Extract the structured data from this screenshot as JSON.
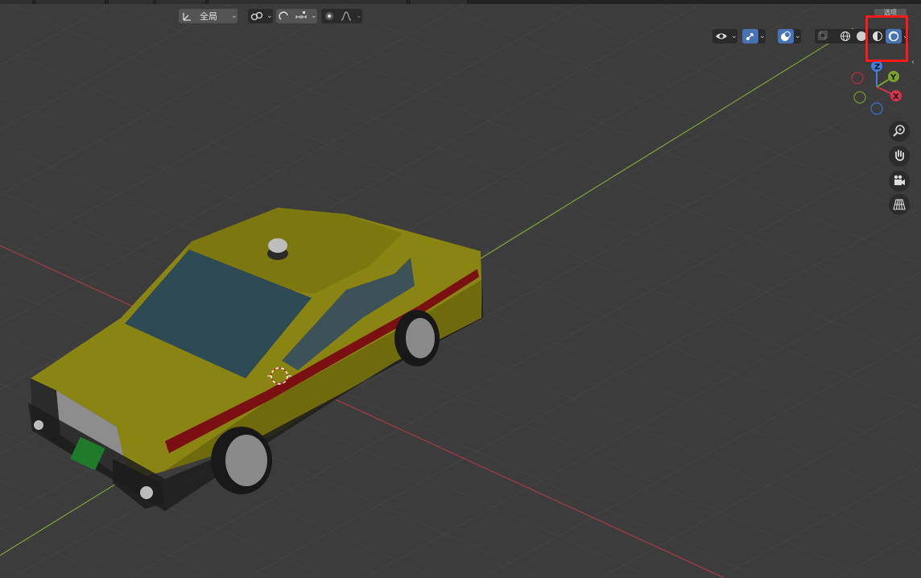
{
  "header": {
    "transform_pivot_label": "全局",
    "options_label": "选项"
  },
  "colors": {
    "background": "#3c3c3c",
    "grid_line": "#474747",
    "x_axis": "#a83a45",
    "y_axis": "#7aa33a",
    "active_button": "#4772b3",
    "taxi_body": "#8a8412",
    "highlight_box": "#ff1a1a"
  },
  "icons": {
    "header_left": [
      "transform-orientation-icon",
      "snap-link-icon",
      "proportional-edit-icon",
      "snap-increment-icon",
      "proportional-falloff-icon"
    ],
    "header_right": [
      "visibility-eye-icon",
      "gizmo-toggle-icon",
      "overlay-icon",
      "xray-icon",
      "wireframe-shading-icon",
      "solid-shading-icon",
      "material-preview-icon",
      "rendered-shading-icon"
    ],
    "navigation": [
      "zoom-icon",
      "pan-hand-icon",
      "camera-view-icon",
      "perspective-grid-icon"
    ]
  },
  "gizmo": {
    "x_label": "X",
    "y_label": "Y",
    "z_label": "Z"
  }
}
